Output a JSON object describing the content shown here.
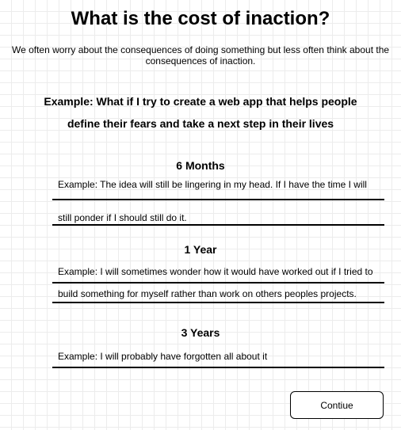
{
  "title": "What is the cost of inaction?",
  "subtitle": "We often worry about the consequences of doing something but less often think about the consequences of inaction.",
  "example_heading": "Example: What if I try to create a web app that helps people define their fears and take a next step in their lives",
  "sections": [
    {
      "title": "6 Months",
      "lines": [
        "Example: The idea will still be lingering in my head.  If I have the time I will",
        "still ponder if I should still do it."
      ]
    },
    {
      "title": "1 Year",
      "lines": [
        "Example: I will sometimes wonder how it would have worked out if I tried to",
        "build something for myself rather than work on others peoples projects."
      ]
    },
    {
      "title": "3 Years",
      "lines": [
        "Example: I will probably have forgotten all about it"
      ]
    }
  ],
  "continue_label": "Contiue"
}
